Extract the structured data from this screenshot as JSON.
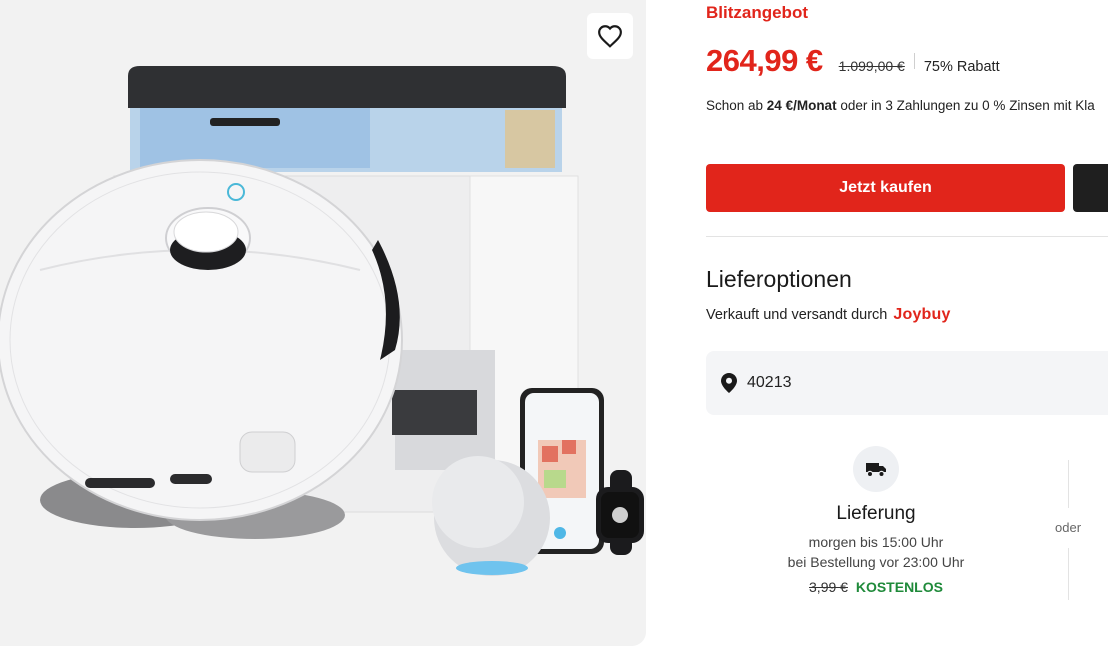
{
  "flash_label": "Blitzangebot",
  "price": {
    "current": "264,99 €",
    "original": "1.099,00 €",
    "discount": "75% Rabatt"
  },
  "installment": {
    "prefix": "Schon ab ",
    "amount": "24 €/Monat",
    "suffix": " oder in 3 Zahlungen zu 0 % Zinsen mit Kla"
  },
  "buy_button": "Jetzt kaufen",
  "delivery_section": {
    "title": "Lieferoptionen",
    "seller_text": "Verkauft und versandt durch",
    "seller_brand": "Joybuy",
    "zip": "40213",
    "option": {
      "title": "Lieferung",
      "line1": "morgen bis 15:00 Uhr",
      "line2": "bei Bestellung vor 23:00 Uhr",
      "old_fee": "3,99 €",
      "fee": "KOSTENLOS"
    },
    "or_label": "oder"
  },
  "colors": {
    "accent": "#e1251b",
    "free": "#1f8a3a",
    "dark_button": "#1f1f1f"
  },
  "icons": {
    "wishlist": "heart-icon",
    "location": "map-pin-icon",
    "delivery": "truck-icon"
  }
}
